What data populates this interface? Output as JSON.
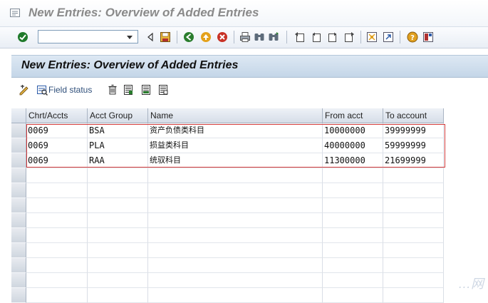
{
  "window": {
    "title": "New Entries: Overview of Added Entries"
  },
  "toolbar": {
    "command_field_value": "",
    "buttons": [
      "enter-icon",
      "back-icon",
      "save-icon",
      "exit-icon",
      "cancel-icon",
      "print-icon",
      "find-icon",
      "find-next-icon",
      "first-page-icon",
      "previous-page-icon",
      "next-page-icon",
      "last-page-icon",
      "new-session-icon",
      "shortcut-icon",
      "help-icon",
      "layout-icon"
    ]
  },
  "screen": {
    "header": "New Entries: Overview of Added Entries"
  },
  "app_toolbar": {
    "field_status_label": "Field status"
  },
  "table": {
    "columns": [
      "Chrt/Accts",
      "Acct Group",
      "Name",
      "From acct",
      "To account"
    ],
    "rows": [
      [
        "0069",
        "BSA",
        "资产负债类科目",
        "10000000",
        "39999999"
      ],
      [
        "0069",
        "PLA",
        "损益类科目",
        "40000000",
        "59999999"
      ],
      [
        "0069",
        "RAA",
        "统驭科目",
        "11300000",
        "21699999"
      ]
    ],
    "empty_rows": 9
  },
  "watermark": "…网",
  "colors": {
    "highlight": "#d23a3a",
    "header_bg": "#c4d6e8"
  }
}
